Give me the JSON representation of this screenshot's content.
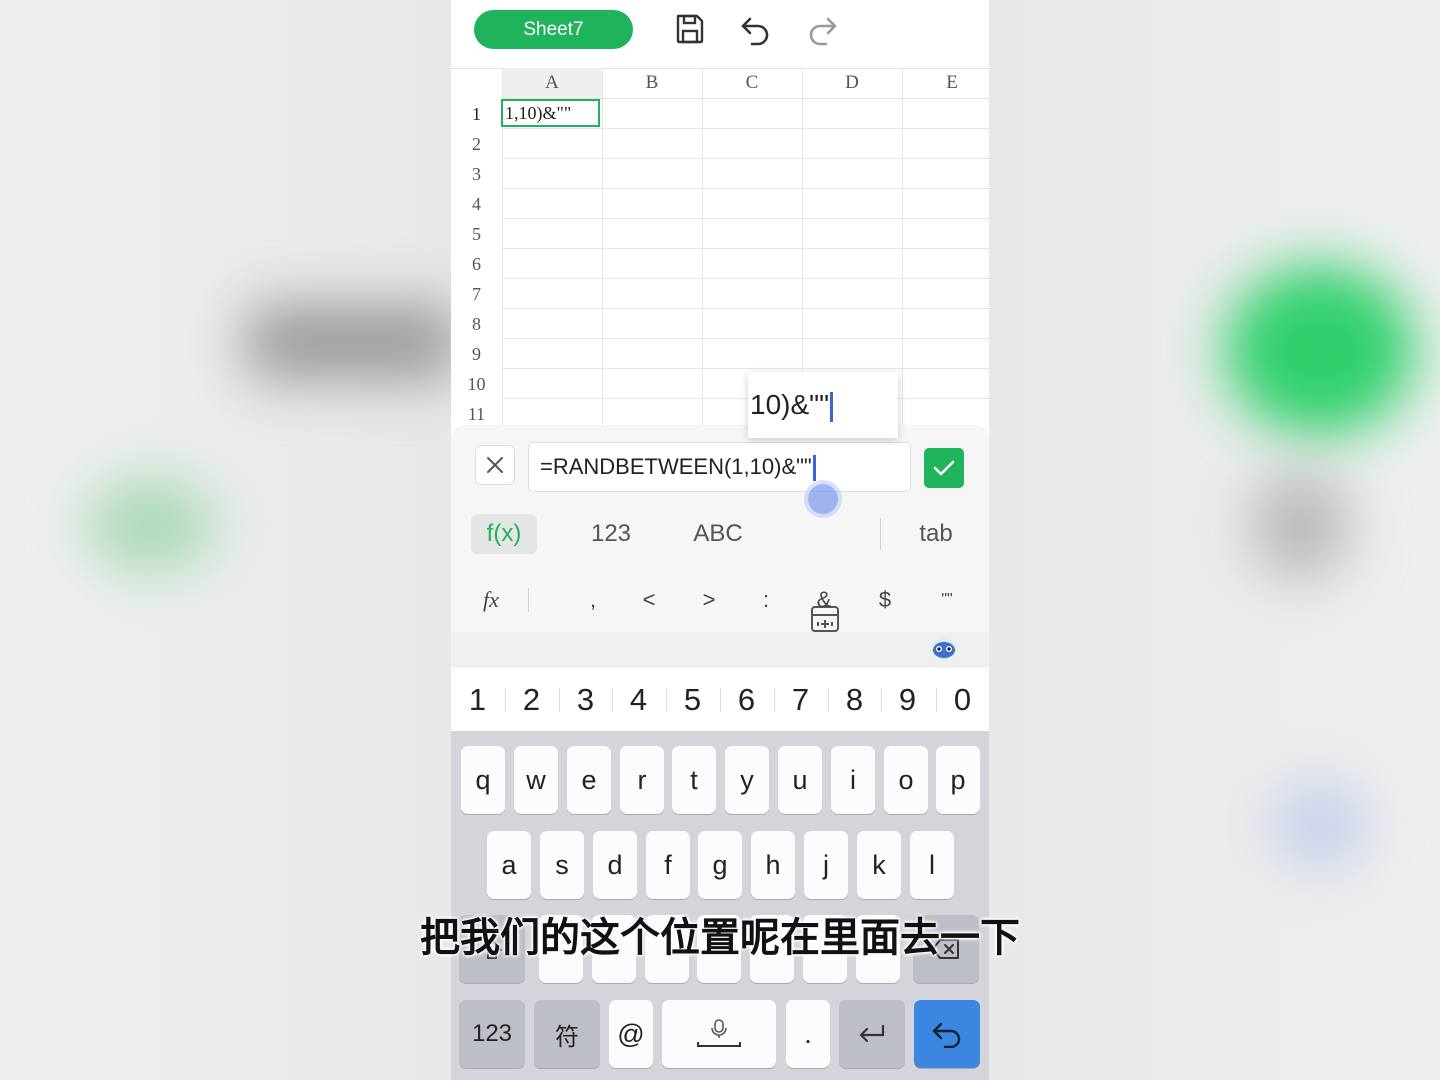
{
  "toolbar": {
    "sheet_name": "Sheet7"
  },
  "grid": {
    "columns": [
      "A",
      "B",
      "C",
      "D",
      "E"
    ],
    "rows": [
      "1",
      "2",
      "3",
      "4",
      "5",
      "6",
      "7",
      "8",
      "9",
      "10",
      "11"
    ],
    "cell_a1": "1,10)&\"\""
  },
  "edit_popup": {
    "text": "10)&\"\""
  },
  "formula_bar": {
    "value": "=RANDBETWEEN(1,10)&\"\""
  },
  "modes": {
    "fx": "f(x)",
    "num": "123",
    "abc": "ABC",
    "tab": "tab"
  },
  "symbols": {
    "fx": "fx",
    "comma": ",",
    "lt": "<",
    "gt": ">",
    "colon": ":",
    "amp": "&",
    "dollar": "$",
    "quote": "\"\""
  },
  "numbers": [
    "1",
    "2",
    "3",
    "4",
    "5",
    "6",
    "7",
    "8",
    "9",
    "0"
  ],
  "keyboard": {
    "row1": [
      "q",
      "w",
      "e",
      "r",
      "t",
      "y",
      "u",
      "i",
      "o",
      "p"
    ],
    "row2": [
      "a",
      "s",
      "d",
      "f",
      "g",
      "h",
      "j",
      "k",
      "l"
    ],
    "bottom": {
      "num": "123",
      "sym": "符",
      "at": "@",
      "dot": "."
    }
  },
  "subtitle": "把我们的这个位置呢在里面去一下",
  "colors": {
    "accent": "#1fb35b",
    "enter": "#3a86e0"
  }
}
